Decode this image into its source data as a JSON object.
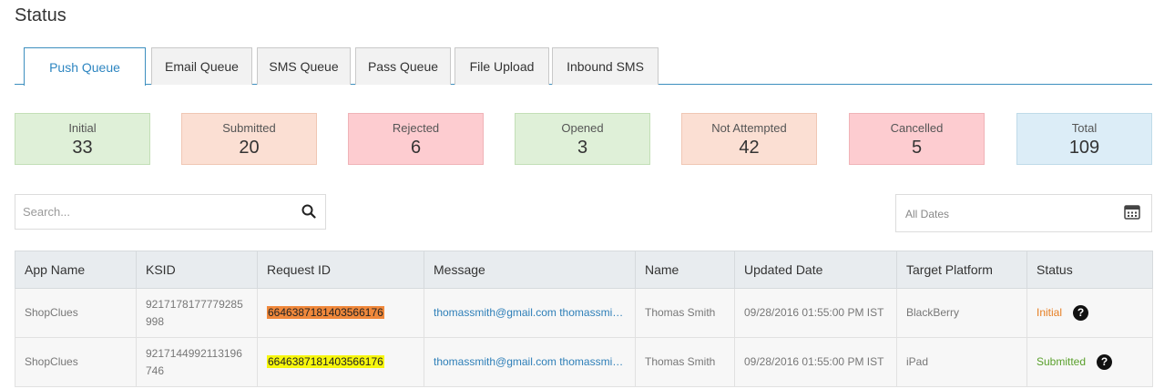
{
  "page": {
    "title": "Status"
  },
  "tabs": [
    {
      "label": "Push  Queue",
      "active": true
    },
    {
      "label": "Email Queue"
    },
    {
      "label": "SMS Queue"
    },
    {
      "label": "Pass Queue"
    },
    {
      "label": "File Upload"
    },
    {
      "label": "Inbound SMS"
    }
  ],
  "stats": [
    {
      "label": "Initial",
      "value": "33",
      "color": "#dff0d8"
    },
    {
      "label": "Submitted",
      "value": "20",
      "color": "#fbdfd3"
    },
    {
      "label": "Rejected",
      "value": "6",
      "color": "#fdccd0"
    },
    {
      "label": "Opened",
      "value": "3",
      "color": "#dff0d8"
    },
    {
      "label": "Not Attempted",
      "value": "42",
      "color": "#fbdfd3"
    },
    {
      "label": "Cancelled",
      "value": "5",
      "color": "#fdccd0"
    },
    {
      "label": "Total",
      "value": "109",
      "color": "#dcedf7"
    }
  ],
  "search": {
    "placeholder": "Search...",
    "icon": "search-icon"
  },
  "date_filter": {
    "value": "All Dates",
    "icon": "calendar-icon"
  },
  "table": {
    "headers": [
      "App Name",
      "KSID",
      "Request ID",
      "Message",
      "Name",
      "Updated Date",
      "Target Platform",
      "Status"
    ],
    "rows": [
      {
        "app_name": "ShopClues",
        "ksid": "9217178177779285998",
        "request_id": "6646387181403566176",
        "message": "thomassmith@gmail.com thomassmith@gmail.com",
        "name": "Thomas Smith",
        "updated_date": "09/28/2016 01:55:00 PM IST",
        "target_platform": "BlackBerry",
        "status": "Initial",
        "status_color": "#e67e22",
        "highlight_color": "#f0883b"
      },
      {
        "app_name": "ShopClues",
        "ksid": "9217144992113196746",
        "request_id": "6646387181403566176",
        "message": "thomassmith@gmail.com thomassmith@gmail.com",
        "name": "Thomas Smith",
        "updated_date": "09/28/2016 01:55:00 PM IST",
        "target_platform": "iPad",
        "status": "Submitted",
        "status_color": "#5aa02c",
        "highlight_color": "#f7f70d"
      }
    ]
  }
}
